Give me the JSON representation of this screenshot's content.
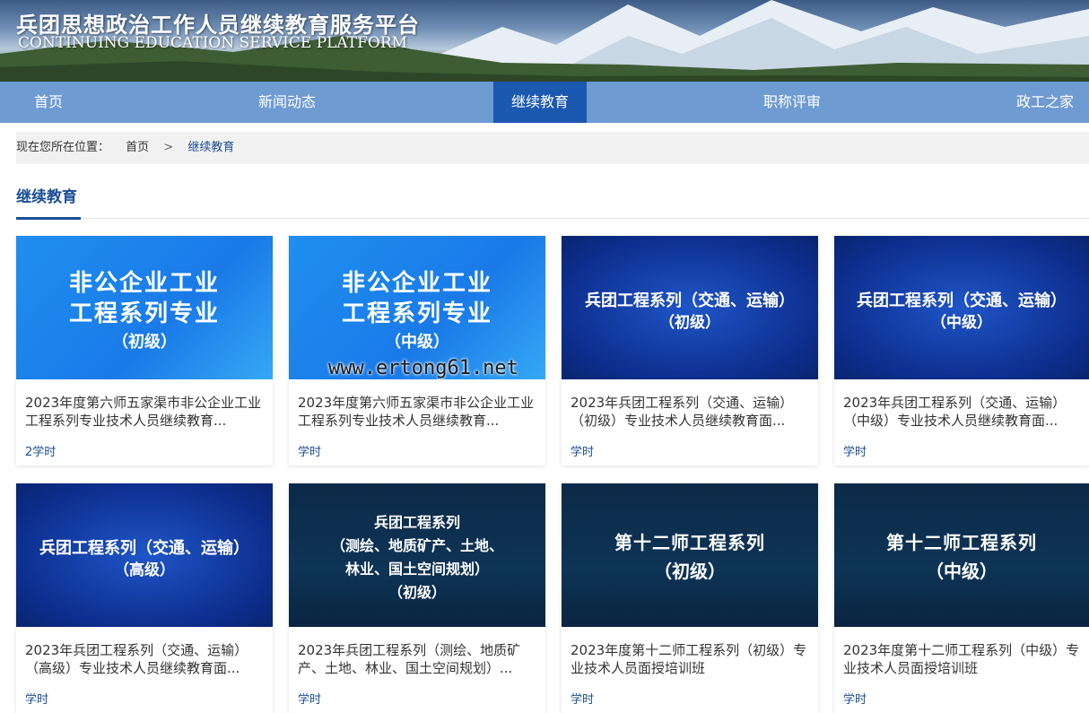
{
  "header": {
    "title": "兵团思想政治工作人员继续教育服务平台",
    "subtitle": "CONTINUING EDUCATION SERVICE PLATFORM"
  },
  "nav": {
    "items": [
      {
        "label": "首页"
      },
      {
        "label": "新闻动态"
      },
      {
        "label": "继续教育"
      },
      {
        "label": "职称评审"
      },
      {
        "label": "政工之家"
      }
    ],
    "active": "继续教育"
  },
  "breadcrumb": {
    "prefix": "现在您所在位置：",
    "home": "首页",
    "separator": ">",
    "current": "继续教育"
  },
  "section": {
    "title": "继续教育"
  },
  "watermark": "www.ertong61.net",
  "colors": {
    "accent": "#1b4f96",
    "nav_bg": "#6f9bd3",
    "nav_active": "#1b58b0"
  },
  "cards": [
    {
      "thumb_lines": [
        "非公企业工业",
        "工程系列专业",
        "（初级）"
      ],
      "title": "2023年度第六师五家渠市非公企业工业工程系列专业技术人员继续教育...",
      "hours": "2学时"
    },
    {
      "thumb_lines": [
        "非公企业工业",
        "工程系列专业",
        "（中级）"
      ],
      "title": "2023年度第六师五家渠市非公企业工业工程系列专业技术人员继续教育...",
      "hours": "学时"
    },
    {
      "thumb_lines": [
        "兵团工程系列（交通、运输）",
        "（初级）"
      ],
      "title": "2023年兵团工程系列（交通、运输）（初级）专业技术人员继续教育面...",
      "hours": "学时"
    },
    {
      "thumb_lines": [
        "兵团工程系列（交通、运输）",
        "（中级）"
      ],
      "title": "2023年兵团工程系列（交通、运输）（中级）专业技术人员继续教育面...",
      "hours": "学时"
    },
    {
      "thumb_lines": [
        "兵团工程系列（交通、运输）",
        "（高级）"
      ],
      "title": "2023年兵团工程系列（交通、运输）（高级）专业技术人员继续教育面...",
      "hours": "学时"
    },
    {
      "thumb_lines": [
        "兵团工程系列",
        "（测绘、地质矿产、土地、",
        "林业、国土空间规划）",
        "（初级）"
      ],
      "title": "2023年兵团工程系列（测绘、地质矿产、土地、林业、国土空间规划）...",
      "hours": "学时"
    },
    {
      "thumb_lines": [
        "第十二师工程系列",
        "（初级）"
      ],
      "title": "2023年度第十二师工程系列（初级）专业技术人员面授培训班",
      "hours": "学时"
    },
    {
      "thumb_lines": [
        "第十二师工程系列",
        "（中级）"
      ],
      "title": "2023年度第十二师工程系列（中级）专业技术人员面授培训班",
      "hours": "学时"
    }
  ]
}
